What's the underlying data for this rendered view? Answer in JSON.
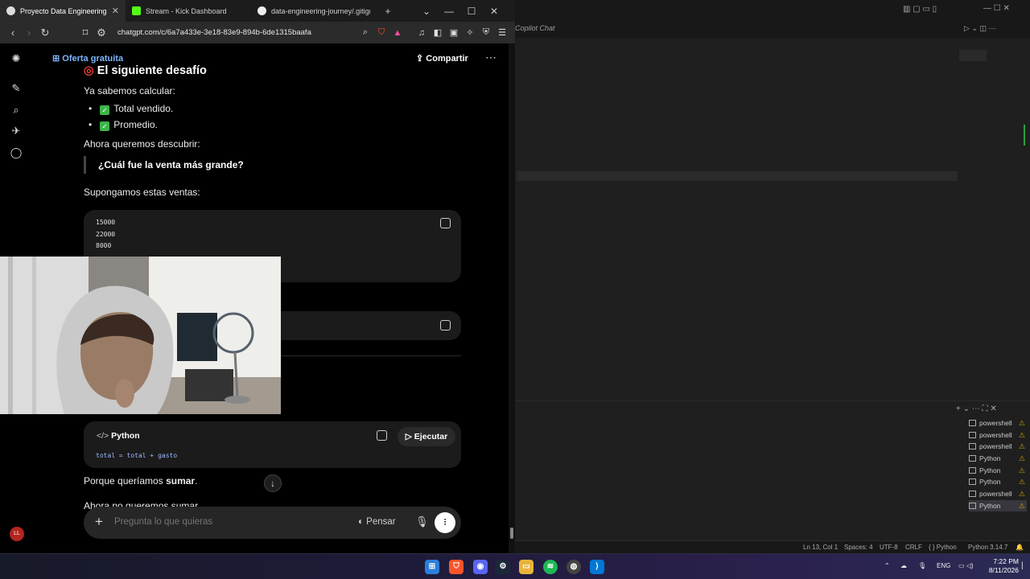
{
  "browser": {
    "tabs": [
      {
        "title": "Proyecto Data Engineering",
        "favicon": "chatgpt-icon",
        "active": true
      },
      {
        "title": "Stream - Kick Dashboard",
        "favicon": "kick-icon",
        "active": false
      },
      {
        "title": "data-engineering-journey/.gitignore",
        "favicon": "github-icon",
        "active": false
      }
    ],
    "url": "chatgpt.com/c/6a7a433e-3e18-83e9-894b-6de1315baafa"
  },
  "chat": {
    "offer": "Oferta gratuita",
    "share": "Compartir",
    "heading": "El siguiente desafío",
    "intro": "Ya sabemos calcular:",
    "bullets": [
      "Total vendido.",
      "Promedio."
    ],
    "discover": "Ahora queremos descubrir:",
    "quote": "¿Cuál fue la venta más grande?",
    "suppose": "Supongamos estas ventas:",
    "sales_code": [
      "15000",
      "22000",
      "8000"
    ],
    "python_label": "Python",
    "run_label": "Ejecutar",
    "python_code": "total = total + gasto",
    "because_prefix": "Porque queríamos ",
    "because_bold": "sumar",
    "because_suffix": ".",
    "now_partial": "Ahora no queremos sumar",
    "composer_placeholder": "Pregunta lo que quieras",
    "think_label": "Pensar",
    "avatar_initials": "LL"
  },
  "vscode": {
    "panel_title": "Copilot Chat",
    "terminals": [
      "powershell",
      "powershell",
      "powershell",
      "Python",
      "Python",
      "Python",
      "powershell",
      "Python"
    ],
    "status": {
      "position": "Ln 13, Col 1",
      "spaces": "Spaces: 4",
      "encoding": "UTF-8",
      "eol": "CRLF",
      "language": "{ } Python",
      "interpreter": "Python 3.14.7"
    }
  },
  "taskbar": {
    "lang": "ENG",
    "time": "7:22 PM",
    "date": "8/11/2026"
  }
}
